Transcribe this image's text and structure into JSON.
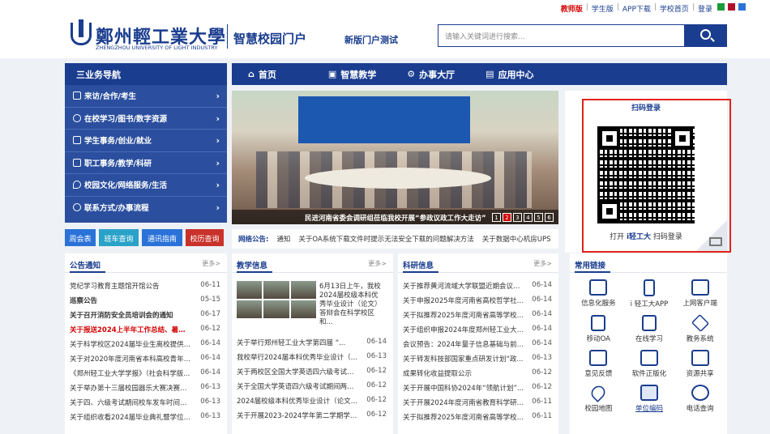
{
  "topbar": {
    "teacher": "教师版",
    "student": "学生版",
    "app": "APP下载",
    "home": "学校首页",
    "login": "登录"
  },
  "colors": {
    "brand": "#1a3d8f",
    "red": "#d40000",
    "sq1": "#1a9a3a",
    "sq2": "#b0102a",
    "sq3": "#2a72d8"
  },
  "header": {
    "logo_cn": "鄭州輕工業大學",
    "logo_en": "ZHENGZHOU UNIVERSITY OF LIGHT INDUSTRY",
    "portal": "智慧校园门户",
    "new_portal": "新版门户测试",
    "search_placeholder": "请输入关键词进行搜索..."
  },
  "sidebar": {
    "title": "三业务导航",
    "items": [
      "来访/合作/考生",
      "在校学习/图书/数字资源",
      "学生事务/创业/就业",
      "职工事务/教学/科研",
      "校园文化/网络服务/生活",
      "联系方式/办事流程"
    ]
  },
  "quick": [
    {
      "label": "周会表",
      "color": "#2a72d8"
    },
    {
      "label": "班车查询",
      "color": "#2aa2c8"
    },
    {
      "label": "通讯指南",
      "color": "#2a72d8"
    },
    {
      "label": "校历查询",
      "color": "#c8322a"
    }
  ],
  "mainnav": [
    {
      "label": "首页",
      "icon": "home-icon"
    },
    {
      "label": "智慧教学",
      "icon": "screen-icon"
    },
    {
      "label": "办事大厅",
      "icon": "gear-icon"
    },
    {
      "label": "应用中心",
      "icon": "apps-icon"
    }
  ],
  "banner": {
    "caption": "民进河南省委会调研组莅临我校开展“参政议政工作大走访”",
    "pages": [
      "1",
      "2",
      "3",
      "4",
      "5",
      "6"
    ],
    "active": "2"
  },
  "notice": {
    "label": "网络公告:",
    "items": [
      "通知",
      "关于OA系统下载文件时提示无法安全下载的问题解决方法",
      "关于数据中心机房UPS"
    ]
  },
  "qr": {
    "title": "扫码登录",
    "foot_pre": "打开",
    "foot_app": "i轻工大",
    "foot_post": "扫码登录"
  },
  "announce": {
    "title": "公告通知",
    "more": "更多>",
    "rows": [
      {
        "t": "党纪学习教育主题馆开馆公告",
        "d": "06-11"
      },
      {
        "t": "巡察公告",
        "d": "05-15"
      },
      {
        "t": "关于召开消防安全员培训会的通知",
        "d": "06-17"
      },
      {
        "t": "关于报送2024上半年工作总结、暑期重...",
        "d": "06-12"
      },
      {
        "t": "关于科学校区2024届毕业生离校提供保障...",
        "d": "06-14"
      },
      {
        "t": "关于对2020年度河南省本科高校青年骨...",
        "d": "06-14"
      },
      {
        "t": "《郑州轻工业大学学报》（社会科学版...",
        "d": "06-14"
      },
      {
        "t": "关于举办第十三届校园器乐大赛决赛的...",
        "d": "06-13"
      },
      {
        "t": "关于四、六级考试期间校车发车时间安...",
        "d": "06-13"
      },
      {
        "t": "关于组织收看2024届毕业典礼暨学位授...",
        "d": "06-13"
      }
    ]
  },
  "teaching": {
    "title": "教学信息",
    "more": "更多>",
    "lead": "6月13日上午，我校2024届校级本科优秀毕业设计（论文）答辩会在科学校区和...",
    "rows": [
      {
        "t": "关于举行郑州轻工业大学第四届 “...",
        "d": "06-14"
      },
      {
        "t": "我校举行2024届本科优秀毕业设计（论...",
        "d": "06-13"
      },
      {
        "t": "关于两校区全国大学英语四六级考试期间两校...",
        "d": "06-12"
      },
      {
        "t": "关于全国大学英语四六级考试期间两校...",
        "d": "06-12"
      },
      {
        "t": "2024届校级本科优秀毕业设计（论文）...",
        "d": "06-12"
      },
      {
        "t": "关于开展2023-2024学年第二学期学生...",
        "d": "06-12"
      }
    ]
  },
  "research": {
    "title": "科研信息",
    "more": "更多>",
    "rows": [
      {
        "t": "关于推荐黄河流域大学联盟近期会议相...",
        "d": "06-14"
      },
      {
        "t": "关于申报2025年度河南省高校哲学社会...",
        "d": "06-14"
      },
      {
        "t": "关于拟推荐2025年度河南省高等学校哲...",
        "d": "06-14"
      },
      {
        "t": "关于组织申报2024年度郑州轻工业大学...",
        "d": "06-14"
      },
      {
        "t": "会议预告：2024年量子信息基础与前沿...",
        "d": "06-14"
      },
      {
        "t": "关于转发科技部国家重点研发计划“政...",
        "d": "06-13"
      },
      {
        "t": "成果转化收益提取公示",
        "d": "06-12"
      },
      {
        "t": "关于开展中国科协2024年“领航计划”...",
        "d": "06-12"
      },
      {
        "t": "关于开展2024年度河南省教育科学研究...",
        "d": "06-11"
      },
      {
        "t": "关于拟推荐2025年度河南省高等学校哲...",
        "d": "06-11"
      }
    ]
  },
  "links": {
    "title": "常用链接",
    "items": [
      "信息化服务",
      "i 轻工大APP",
      "上网客户端",
      "移动OA",
      "在线学习",
      "教务系统",
      "意见反馈",
      "软件正版化",
      "资源共享",
      "校园地图",
      "单位编码",
      "电话查询"
    ],
    "selected": "单位编码"
  }
}
